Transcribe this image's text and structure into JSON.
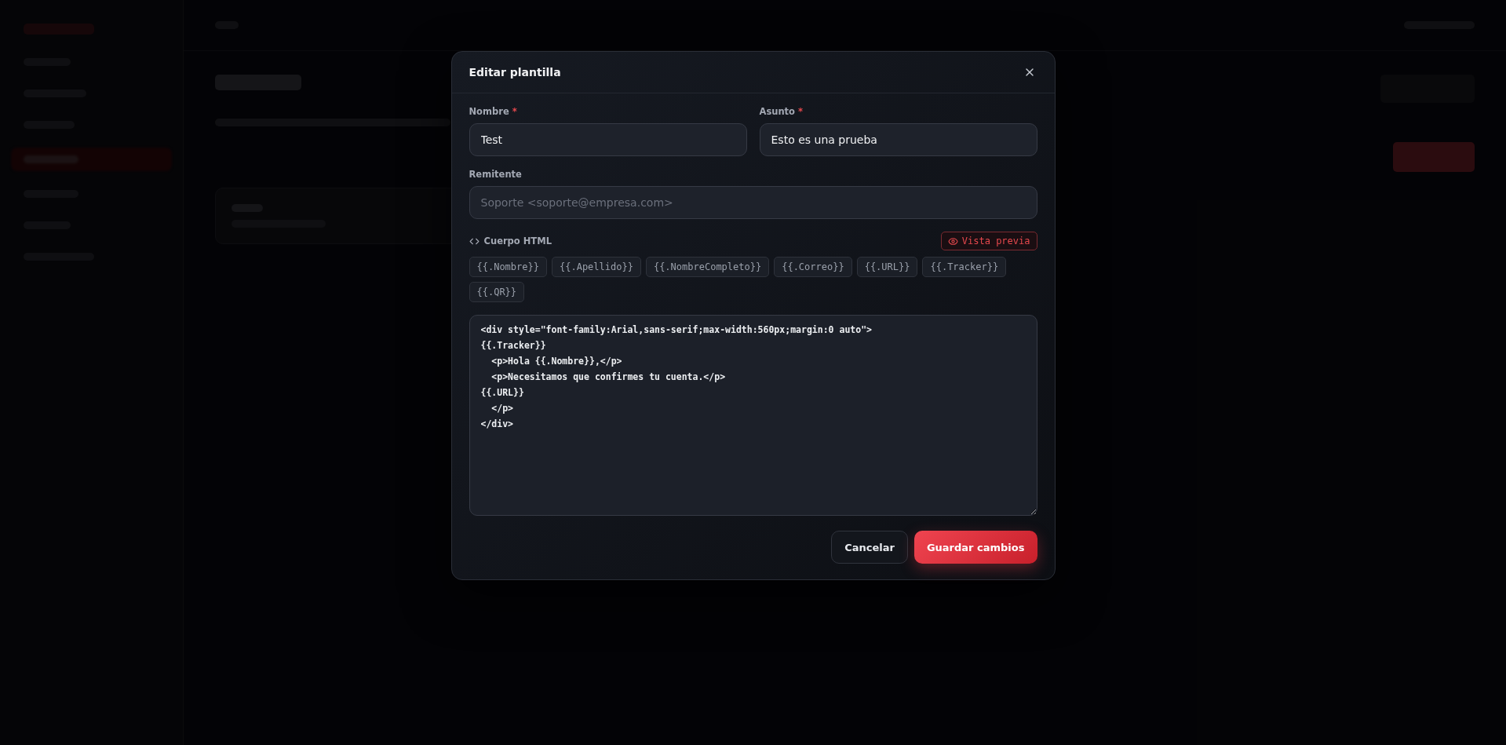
{
  "dialog": {
    "title": "Editar plantilla",
    "required_mark": "*",
    "fields": [
      {
        "label": "Nombre",
        "required": true,
        "value": "Test"
      },
      {
        "label": "Asunto",
        "required": true,
        "value": "Esto es una prueba"
      },
      {
        "label": "Remitente",
        "required": false,
        "placeholder": "Soporte <soporte@empresa.com>"
      }
    ],
    "body_label": "Cuerpo HTML",
    "preview_button": "Vista previa",
    "variables": [
      "{{.Nombre}}",
      "{{.Apellido}}",
      "{{.NombreCompleto}}",
      "{{.Correo}}",
      "{{.URL}}",
      "{{.Tracker}}",
      "{{.QR}}"
    ],
    "code_lines": [
      "<div style=\"font-family:Arial,sans-serif;max-width:560px;margin:0 auto\">",
      "{{.Tracker}}",
      "  <p>Hola {{.Nombre}},</p>",
      "  <p>Necesitamos que confirmes tu cuenta.</p>",
      "{{.URL}}",
      "  </p>",
      "</div>"
    ],
    "buttons": [
      {
        "label": "Cancelar",
        "kind": "secondary"
      },
      {
        "label": "Guardar cambios",
        "kind": "primary"
      }
    ]
  }
}
